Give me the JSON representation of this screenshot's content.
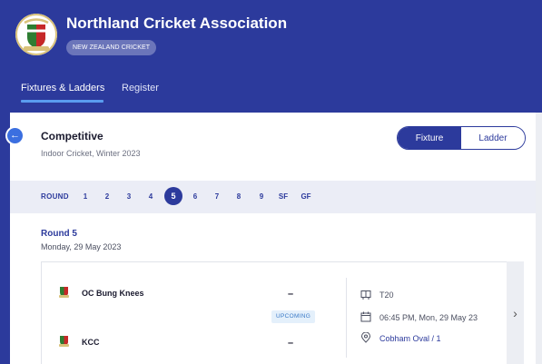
{
  "header": {
    "title": "Northland Cricket Association",
    "badge": "NEW ZEALAND CRICKET",
    "nav": [
      {
        "label": "Fixtures & Ladders",
        "active": true
      },
      {
        "label": "Register",
        "active": false
      }
    ]
  },
  "competition": {
    "title": "Competitive",
    "subtitle": "Indoor Cricket, Winter 2023",
    "toggle": [
      {
        "label": "Fixture",
        "active": true
      },
      {
        "label": "Ladder",
        "active": false
      }
    ]
  },
  "rounds": {
    "label": "ROUND",
    "items": [
      "1",
      "2",
      "3",
      "4",
      "5",
      "6",
      "7",
      "8",
      "9",
      "SF",
      "GF"
    ],
    "selected": "5"
  },
  "round_info": {
    "title": "Round 5",
    "date": "Monday, 29 May 2023"
  },
  "match": {
    "home": {
      "name": "OC Bung Knees",
      "score": "–"
    },
    "away": {
      "name": "KCC",
      "score": "–"
    },
    "status": "UPCOMING",
    "format": "T20",
    "datetime": "06:45 PM, Mon, 29 May 23",
    "venue": "Cobham Oval / 1"
  },
  "colors": {
    "brand": "#2c3a9c",
    "accent": "#5a9cf0",
    "status": "#3a79c7"
  },
  "icons": {
    "back": "arrow-left-icon",
    "next": "chevron-right-icon",
    "format": "scoreboard-icon",
    "date": "calendar-icon",
    "venue": "location-pin-icon"
  }
}
